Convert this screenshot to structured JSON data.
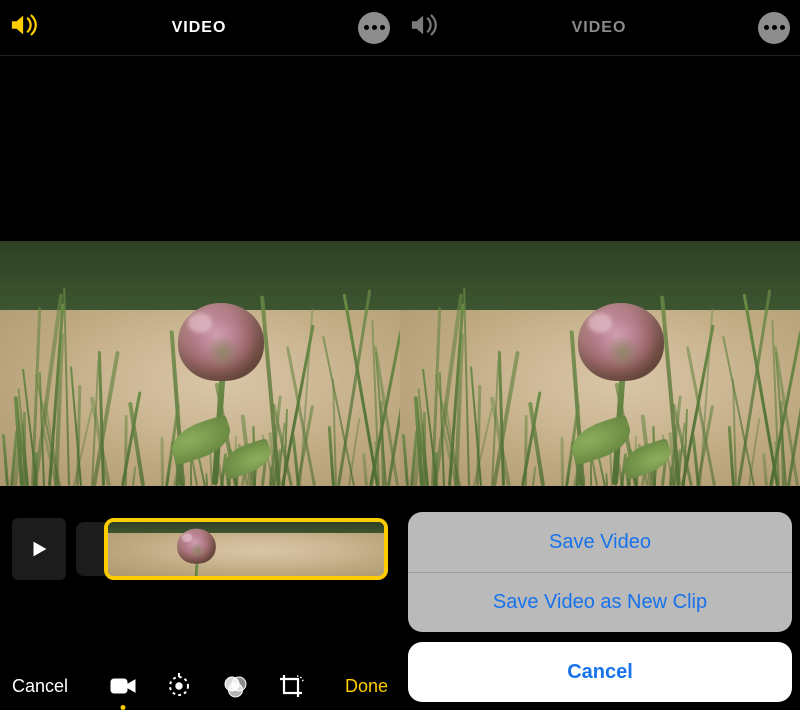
{
  "left": {
    "header": {
      "title": "VIDEO"
    },
    "toolbar": {
      "cancel": "Cancel",
      "done": "Done"
    },
    "scrubber": {
      "left_handle": "❨",
      "right_handle": "❩"
    }
  },
  "right": {
    "header": {
      "title": "VIDEO"
    },
    "sheet": {
      "save": "Save Video",
      "save_new": "Save Video as New Clip",
      "cancel": "Cancel"
    }
  },
  "colors": {
    "accent": "#ffcc00",
    "ios_blue": "#1772eb"
  }
}
